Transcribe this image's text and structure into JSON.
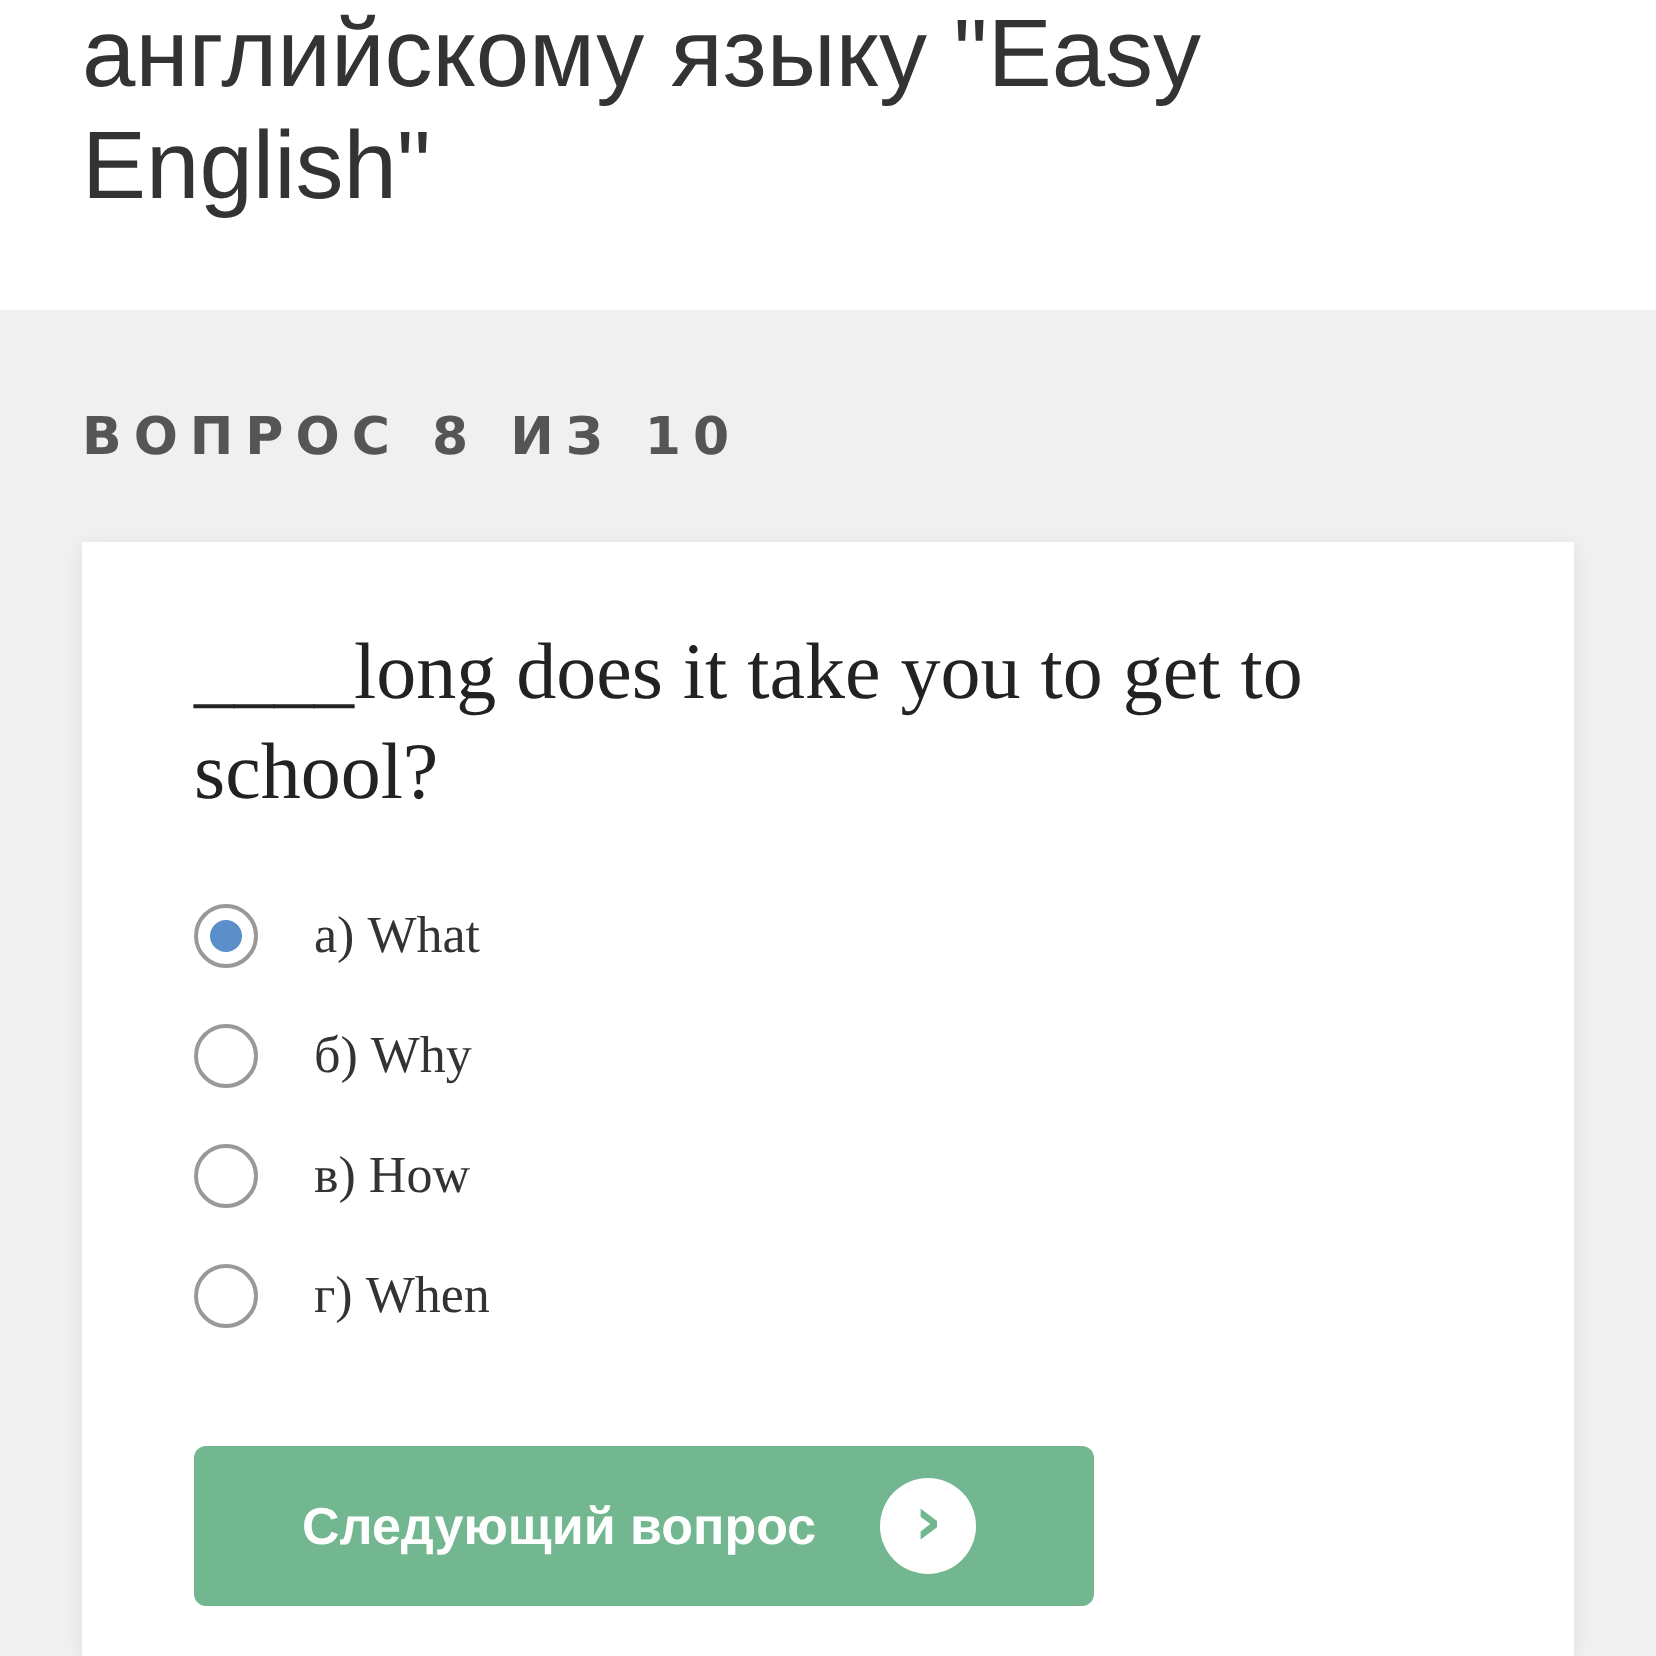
{
  "header": {
    "title": "английскому языку \"Easy English\""
  },
  "question_counter": "ВОПРОС 8 ИЗ 10",
  "question": {
    "text": "____long does it take you to get to school?",
    "options": [
      {
        "label": "а) What",
        "selected": true
      },
      {
        "label": "б) Why",
        "selected": false
      },
      {
        "label": "в) How",
        "selected": false
      },
      {
        "label": "г) When",
        "selected": false
      }
    ]
  },
  "next_button": {
    "label": "Следующий вопрос",
    "icon": "›"
  }
}
